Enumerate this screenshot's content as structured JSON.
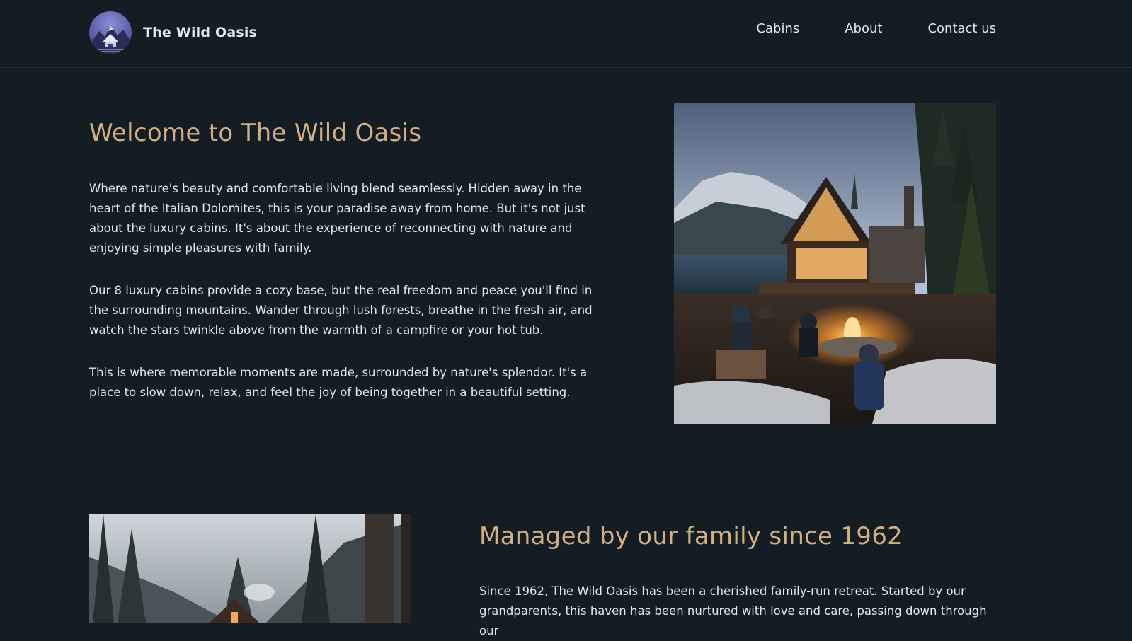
{
  "header": {
    "brand": "The Wild Oasis",
    "nav": [
      {
        "label": "Cabins"
      },
      {
        "label": "About"
      },
      {
        "label": "Contact us"
      }
    ]
  },
  "intro": {
    "title": "Welcome to The Wild Oasis",
    "paragraphs": [
      "Where nature's beauty and comfortable living blend seamlessly. Hidden away in the heart of the Italian Dolomites, this is your paradise away from home. But it's not just about the luxury cabins. It's about the experience of reconnecting with nature and enjoying simple pleasures with family.",
      "Our 8 luxury cabins provide a cozy base, but the real freedom and peace you'll find in the surrounding mountains. Wander through lush forests, breathe in the fresh air, and watch the stars twinkle above from the warmth of a campfire or your hot tub.",
      "This is where memorable moments are made, surrounded by nature's splendor. It's a place to slow down, relax, and feel the joy of being together in a beautiful setting."
    ]
  },
  "family": {
    "title": "Managed by our family since 1962",
    "paragraph": "Since 1962, The Wild Oasis has been a cherished family-run retreat. Started by our grandparents, this haven has been nurtured with love and care, passing down through our"
  },
  "colors": {
    "background": "#141c24",
    "accent": "#d2af84",
    "text": "#e5e7eb"
  }
}
